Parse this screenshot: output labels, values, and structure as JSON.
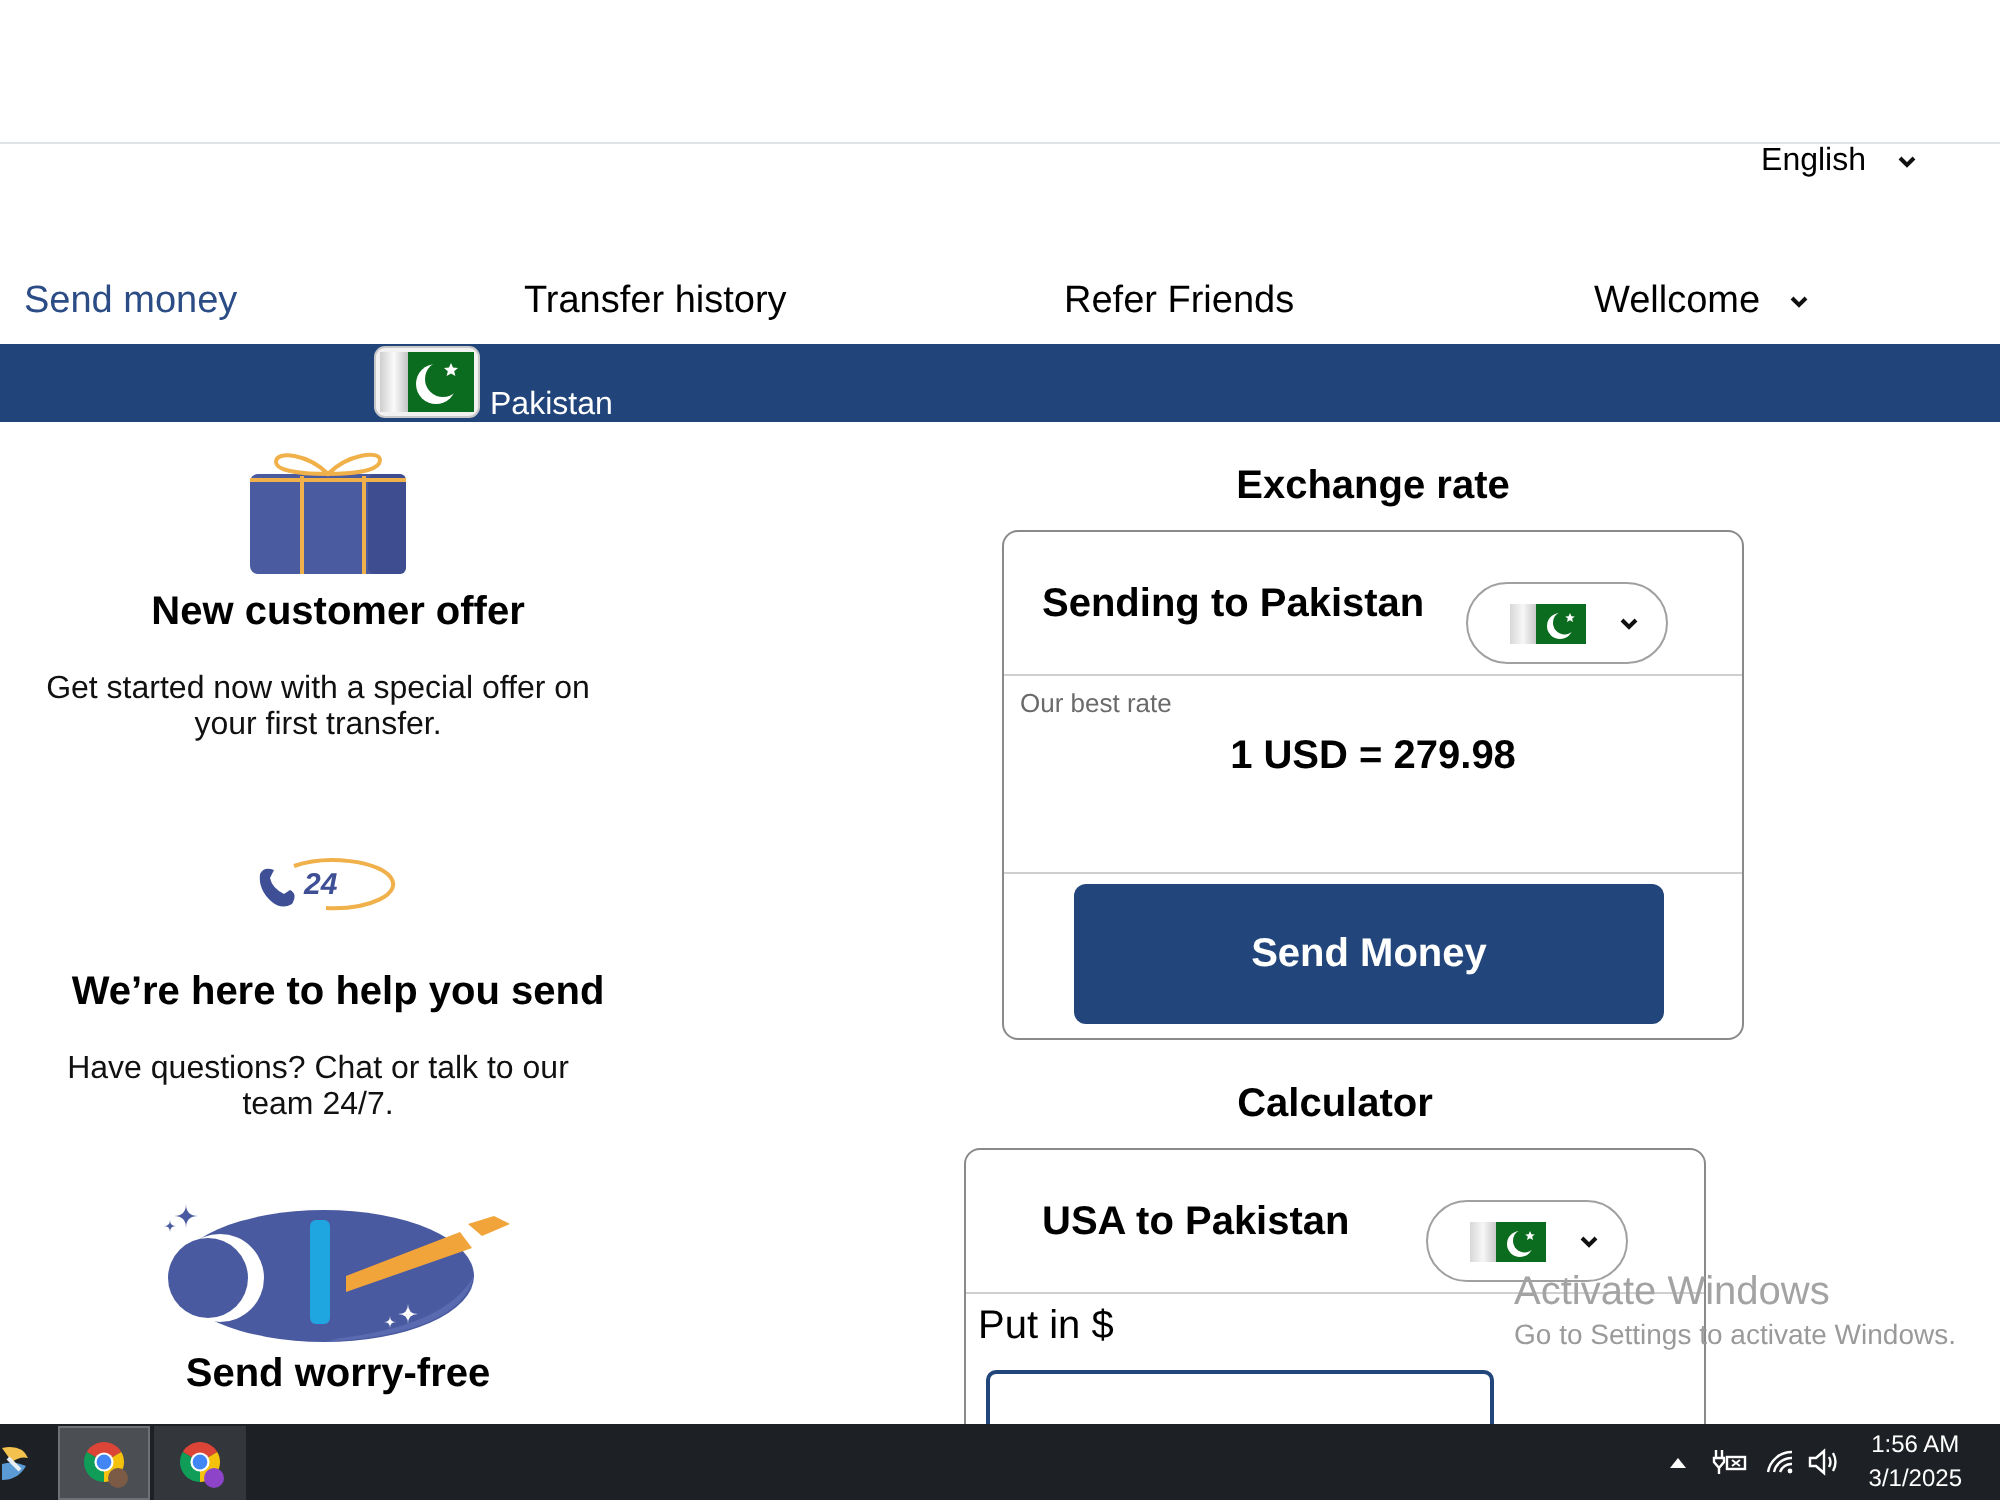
{
  "language_selector": {
    "label": "English"
  },
  "nav": {
    "items": [
      {
        "label": "Send money",
        "selected": true
      },
      {
        "label": "Transfer history",
        "selected": false
      },
      {
        "label": "Refer Friends",
        "selected": false
      }
    ],
    "account_menu": {
      "label": "Wellcome"
    }
  },
  "country_bar": {
    "country": "Pakistan"
  },
  "features": [
    {
      "kind": "gift",
      "title": "New customer offer",
      "description": "Get started now with a special offer on your first transfer."
    },
    {
      "kind": "support",
      "icon_label": "24",
      "title": "We’re here to help you send",
      "description": "Have questions? Chat or talk to our team 24/7."
    },
    {
      "kind": "worry_free",
      "title": "Send worry-free"
    }
  ],
  "exchange_rate": {
    "heading": "Exchange rate",
    "card_title": "Sending to Pakistan",
    "rate_label": "Our best rate",
    "rate": "1 USD = 279.98",
    "button": "Send Money"
  },
  "calculator": {
    "heading": "Calculator",
    "card_title": "USA to Pakistan",
    "amount_label": "Put in $"
  },
  "windows_activation_notice": {
    "title": "Activate Windows",
    "message": "Go to Settings to activate Windows."
  },
  "taskbar": {
    "apps": [
      {
        "kind": "app",
        "selected": false
      },
      {
        "kind": "browser",
        "selected": true,
        "color": "#7b5b45"
      },
      {
        "kind": "browser",
        "selected": false,
        "color": "#8e44c9"
      }
    ],
    "time": "1:56 AM",
    "date": "3/1/2025"
  }
}
